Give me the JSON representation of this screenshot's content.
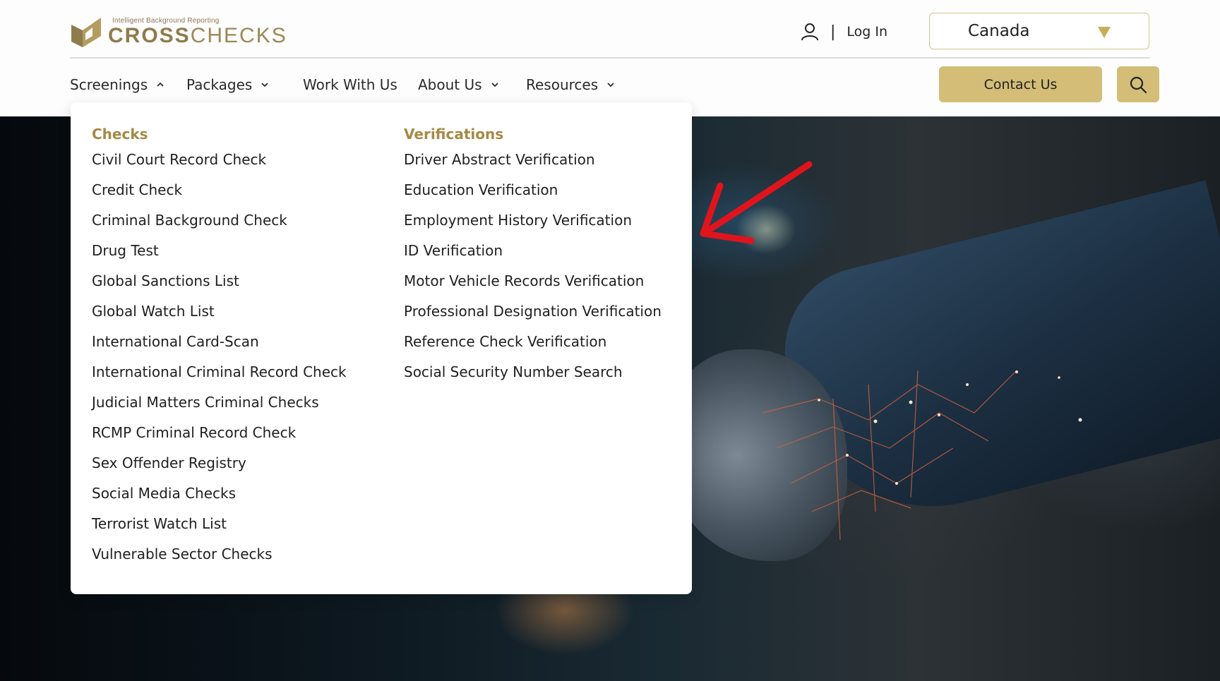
{
  "brand": {
    "tagline": "Intelligent Background Reporting",
    "name_bold": "CROSS",
    "name_light": "CHECKS",
    "colors": {
      "gold": "#d3bd77",
      "gold_dark": "#a58a45"
    }
  },
  "header": {
    "login_label": "Log In",
    "login_separator": "|",
    "country": {
      "selected": "Canada"
    }
  },
  "nav": {
    "items": [
      {
        "label": "Screenings",
        "has_dropdown": true,
        "open": true
      },
      {
        "label": "Packages",
        "has_dropdown": true,
        "open": false
      },
      {
        "label": "Work With Us",
        "has_dropdown": false
      },
      {
        "label": "About Us",
        "has_dropdown": true,
        "open": false
      },
      {
        "label": "Resources",
        "has_dropdown": true,
        "open": false
      }
    ],
    "contact_label": "Contact Us",
    "search_icon": "search-icon"
  },
  "dropdown": {
    "checks": {
      "title": "Checks",
      "items": [
        "Civil Court Record Check",
        "Credit Check",
        "Criminal Background Check",
        "Drug Test",
        "Global Sanctions List",
        "Global Watch List",
        "International Card-Scan",
        "International Criminal Record Check",
        "Judicial Matters Criminal Checks",
        "RCMP Criminal Record Check",
        "Sex Offender Registry",
        "Social Media Checks",
        "Terrorist Watch List",
        "Vulnerable Sector Checks"
      ]
    },
    "verifications": {
      "title": "Verifications",
      "items": [
        "Driver Abstract Verification",
        "Education Verification",
        "Employment History Verification",
        "ID Verification",
        "Motor Vehicle Records Verification",
        "Professional Designation Verification",
        "Reference Check Verification",
        "Social Security Number Search"
      ]
    }
  },
  "annotation": {
    "arrow_color": "#e0141c"
  }
}
